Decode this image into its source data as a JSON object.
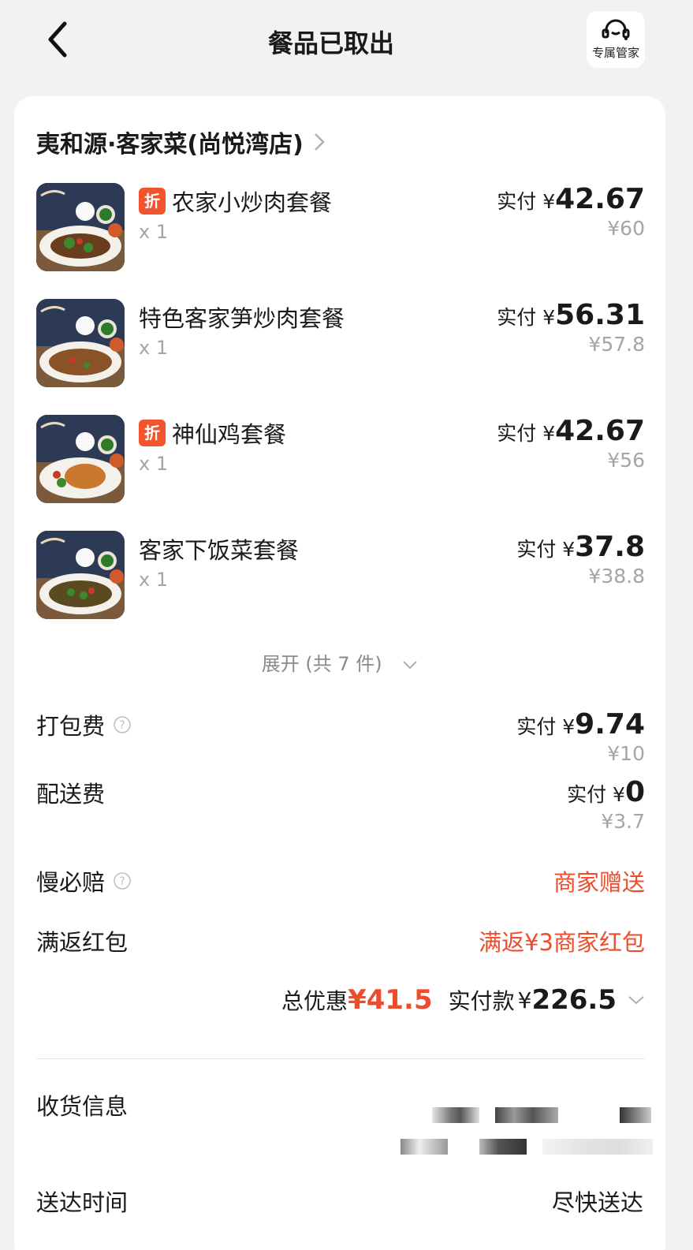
{
  "header": {
    "title": "餐品已取出",
    "manager_label": "专属管家"
  },
  "shop": {
    "name": "夷和源·客家菜(尚悦湾店)"
  },
  "items": [
    {
      "name": "农家小炒肉套餐",
      "tag": "折",
      "qty": "x 1",
      "paid_prefix": "实付 ¥",
      "paid": "42.67",
      "original": "¥60"
    },
    {
      "name": "特色客家笋炒肉套餐",
      "tag": "",
      "qty": "x 1",
      "paid_prefix": "实付 ¥",
      "paid": "56.31",
      "original": "¥57.8"
    },
    {
      "name": "神仙鸡套餐",
      "tag": "折",
      "qty": "x 1",
      "paid_prefix": "实付 ¥",
      "paid": "42.67",
      "original": "¥56"
    },
    {
      "name": "客家下饭菜套餐",
      "tag": "",
      "qty": "x 1",
      "paid_prefix": "实付 ¥",
      "paid": "37.8",
      "original": "¥38.8"
    }
  ],
  "expand_label": "展开 (共 7 件)",
  "fees": {
    "packing": {
      "label": "打包费",
      "paid_prefix": "实付 ¥",
      "paid": "9.74",
      "original": "¥10"
    },
    "delivery": {
      "label": "配送费",
      "paid_prefix": "实付 ¥",
      "paid": "0",
      "original": "¥3.7"
    },
    "slow_comp": {
      "label": "慢必赔",
      "value": "商家赠送"
    },
    "cashback": {
      "label": "满返红包",
      "value": "满返¥3商家红包"
    }
  },
  "summary": {
    "discount_label": "总优惠",
    "discount_value": "¥41.5",
    "total_label": "实付款",
    "total_currency": "¥",
    "total_value": "226.5"
  },
  "receiver": {
    "label": "收货信息"
  },
  "delivery_time": {
    "label": "送达时间",
    "value": "尽快送达"
  },
  "colors": {
    "accent": "#ee4d2d",
    "tag": "#f2542d",
    "muted": "#a5a5a5",
    "background": "#f2f2f2"
  }
}
